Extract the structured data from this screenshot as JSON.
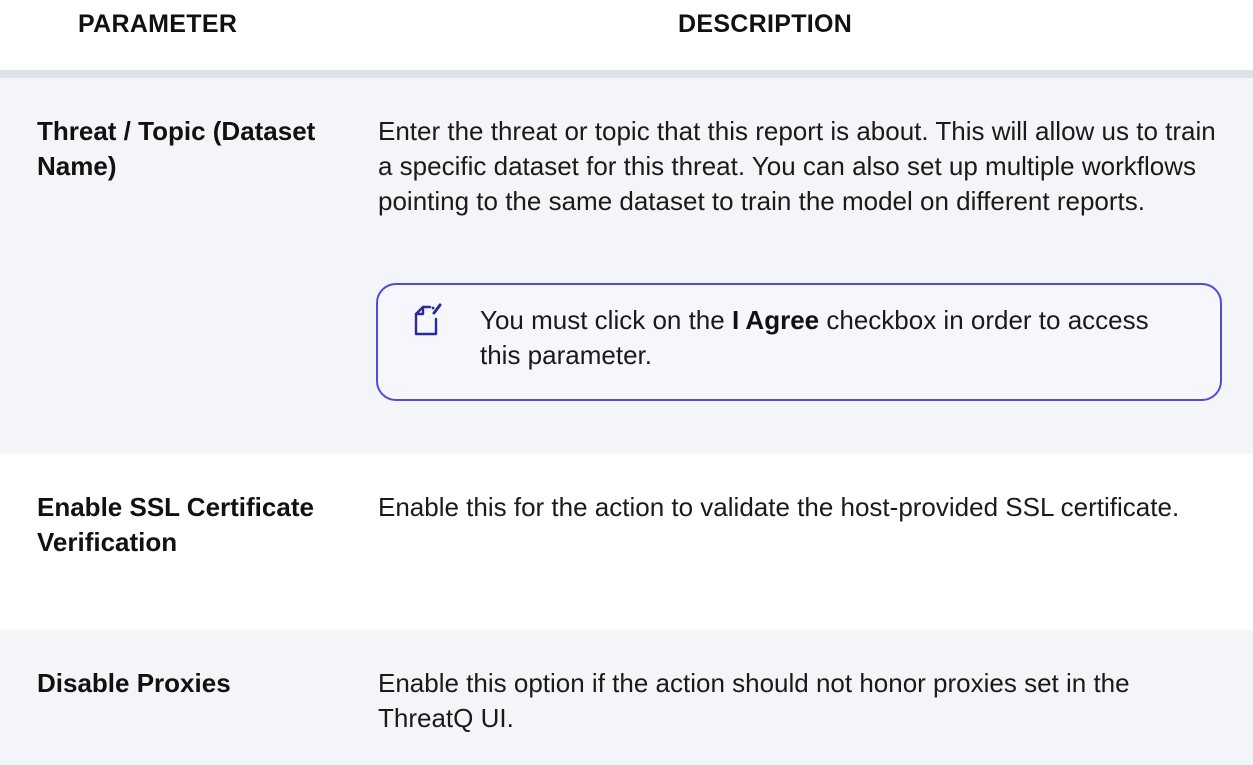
{
  "header": {
    "parameter_label": "PARAMETER",
    "description_label": "DESCRIPTION"
  },
  "rows": [
    {
      "parameter": "Threat / Topic (Dataset Name)",
      "description": "Enter the threat or topic that this report is about. This will allow us to train a specific dataset for this threat. You can also set up multiple workflows pointing to the same dataset to train the model on different reports.",
      "note": {
        "icon": "note-pencil-icon",
        "text_before": "You must click on the ",
        "text_bold": "I Agree",
        "text_after": " checkbox in order to access this parameter."
      }
    },
    {
      "parameter": "Enable SSL Certificate Verification",
      "description": "Enable this for the action to validate the host-provided SSL certificate."
    },
    {
      "parameter": "Disable Proxies",
      "description": "Enable this option if the action should not honor proxies set in the ThreatQ UI."
    }
  ],
  "colors": {
    "header_divider": "#dde1e8",
    "row_shaded": "#f4f5f8",
    "note_border": "#4c4ed8",
    "note_icon": "#2a2a9a"
  }
}
